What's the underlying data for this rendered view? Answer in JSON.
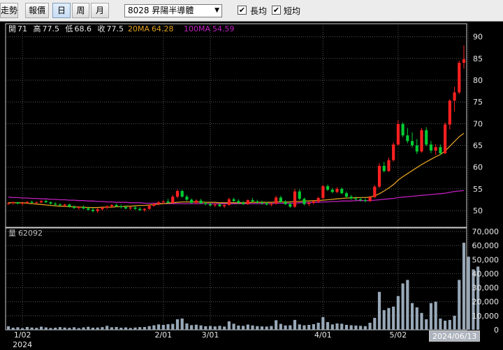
{
  "toolbar": {
    "buttons": [
      {
        "label": "走勢",
        "active": false
      },
      {
        "label": "報價",
        "active": false
      },
      {
        "label": "日",
        "active": true
      },
      {
        "label": "周",
        "active": false
      },
      {
        "label": "月",
        "active": false
      }
    ],
    "stock_select": "8028 昇陽半導體",
    "long_ma": {
      "label": "長均",
      "checked": true
    },
    "short_ma": {
      "label": "短均",
      "checked": true
    }
  },
  "info": {
    "open_label": "開",
    "open": "71",
    "high_label": "高",
    "high": "77.5",
    "low_label": "低",
    "low": "68.6",
    "close_label": "收",
    "close": "77.5",
    "ma20_label": "20MA",
    "ma20": "64.28",
    "ma100_label": "100MA",
    "ma100": "54.59",
    "volume_label": "量",
    "volume": "62092"
  },
  "date_flag": "2024/06/13",
  "colors": {
    "up": "#ff2020",
    "down": "#00cc33",
    "ma20": "#e0a020",
    "ma100": "#c020c0",
    "volume": "#98a8b8",
    "grid": "#555555"
  },
  "chart_data": {
    "type": "candlestick",
    "price_axis": {
      "ticks": [
        "50",
        "55",
        "60",
        "65",
        "70",
        "75",
        "80",
        "85",
        "90"
      ],
      "range": [
        46,
        93
      ]
    },
    "volume_axis": {
      "ticks": [
        "0",
        "10,000",
        "20,000",
        "30,000",
        "40,000",
        "50,000",
        "60,000",
        "70,000"
      ],
      "range": [
        0,
        70000
      ]
    },
    "x_labels": [
      "1/02",
      "2/01",
      "3/01",
      "4/01",
      "5/02",
      "6/0"
    ],
    "year_label": "2024",
    "candles": [
      [
        51.6,
        51.9,
        51.3,
        51.7
      ],
      [
        51.7,
        52.1,
        51.4,
        51.9
      ],
      [
        51.9,
        52.0,
        51.5,
        51.6
      ],
      [
        51.6,
        51.9,
        51.2,
        51.8
      ],
      [
        51.8,
        52.2,
        51.6,
        52.0
      ],
      [
        52.0,
        52.3,
        51.7,
        51.8
      ],
      [
        51.8,
        52.1,
        51.5,
        51.9
      ],
      [
        51.9,
        52.4,
        51.7,
        52.2
      ],
      [
        52.2,
        52.5,
        51.8,
        51.9
      ],
      [
        51.9,
        52.1,
        51.4,
        51.6
      ],
      [
        51.6,
        51.9,
        51.1,
        51.4
      ],
      [
        51.4,
        51.7,
        51.0,
        51.2
      ],
      [
        51.2,
        51.6,
        50.8,
        51.4
      ],
      [
        51.4,
        51.6,
        50.7,
        50.9
      ],
      [
        50.9,
        51.2,
        50.4,
        50.6
      ],
      [
        50.6,
        51.0,
        50.2,
        50.8
      ],
      [
        50.8,
        51.2,
        50.3,
        50.5
      ],
      [
        50.5,
        50.9,
        50.0,
        50.2
      ],
      [
        50.2,
        50.6,
        49.6,
        49.9
      ],
      [
        49.9,
        50.6,
        49.5,
        50.3
      ],
      [
        50.3,
        50.9,
        50.0,
        50.7
      ],
      [
        50.7,
        51.2,
        50.3,
        51.0
      ],
      [
        51.0,
        51.5,
        50.6,
        51.3
      ],
      [
        51.3,
        51.6,
        50.8,
        51.0
      ],
      [
        51.0,
        51.4,
        50.5,
        50.8
      ],
      [
        50.8,
        51.2,
        50.3,
        50.5
      ],
      [
        50.5,
        50.9,
        50.1,
        50.7
      ],
      [
        50.7,
        51.1,
        50.2,
        50.4
      ],
      [
        50.4,
        50.8,
        49.9,
        50.1
      ],
      [
        50.1,
        50.6,
        49.7,
        50.4
      ],
      [
        50.4,
        51.3,
        50.2,
        51.1
      ],
      [
        51.1,
        51.8,
        50.9,
        51.5
      ],
      [
        51.5,
        52.2,
        51.2,
        51.9
      ],
      [
        51.9,
        52.4,
        51.5,
        52.1
      ],
      [
        52.1,
        52.7,
        51.7,
        51.8
      ],
      [
        51.8,
        53.6,
        51.6,
        53.2
      ],
      [
        53.2,
        54.9,
        52.8,
        54.5
      ],
      [
        54.5,
        54.8,
        53.0,
        53.2
      ],
      [
        53.2,
        53.6,
        52.2,
        52.5
      ],
      [
        52.5,
        52.8,
        51.6,
        51.8
      ],
      [
        51.8,
        52.6,
        51.5,
        52.3
      ],
      [
        52.3,
        52.7,
        51.6,
        51.7
      ],
      [
        51.7,
        52.0,
        51.2,
        51.5
      ],
      [
        51.5,
        51.8,
        50.9,
        51.2
      ],
      [
        51.2,
        51.6,
        50.8,
        51.4
      ],
      [
        51.4,
        51.7,
        50.9,
        51.0
      ],
      [
        51.0,
        51.5,
        50.6,
        51.3
      ],
      [
        51.3,
        53.0,
        51.1,
        52.6
      ],
      [
        52.6,
        53.0,
        52.0,
        52.2
      ],
      [
        52.2,
        52.6,
        51.5,
        51.8
      ],
      [
        51.8,
        52.2,
        51.3,
        51.5
      ],
      [
        51.5,
        52.6,
        51.3,
        52.4
      ],
      [
        52.4,
        52.9,
        51.9,
        52.1
      ],
      [
        52.1,
        52.5,
        51.6,
        51.9
      ],
      [
        51.9,
        52.3,
        51.4,
        51.7
      ],
      [
        51.7,
        52.0,
        51.2,
        51.4
      ],
      [
        51.4,
        51.9,
        51.0,
        51.6
      ],
      [
        51.6,
        53.4,
        51.4,
        53.0
      ],
      [
        53.0,
        53.4,
        51.9,
        52.0
      ],
      [
        52.0,
        52.4,
        51.3,
        51.5
      ],
      [
        51.5,
        51.9,
        50.6,
        50.9
      ],
      [
        50.9,
        55.0,
        50.6,
        54.4
      ],
      [
        54.4,
        54.9,
        52.4,
        52.7
      ],
      [
        52.7,
        53.0,
        51.2,
        51.5
      ],
      [
        51.5,
        52.1,
        51.0,
        51.8
      ],
      [
        51.8,
        52.4,
        51.4,
        52.1
      ],
      [
        52.1,
        53.2,
        51.8,
        52.9
      ],
      [
        52.9,
        55.9,
        52.6,
        55.6
      ],
      [
        55.6,
        56.0,
        54.5,
        54.8
      ],
      [
        54.8,
        55.2,
        54.0,
        54.3
      ],
      [
        54.3,
        55.4,
        54.0,
        55.0
      ],
      [
        55.0,
        55.3,
        53.8,
        54.0
      ],
      [
        54.0,
        54.4,
        52.9,
        53.2
      ],
      [
        53.2,
        53.6,
        52.5,
        52.8
      ],
      [
        52.8,
        53.2,
        52.3,
        52.6
      ],
      [
        52.6,
        53.0,
        52.1,
        52.4
      ],
      [
        52.4,
        52.8,
        51.9,
        52.2
      ],
      [
        52.2,
        53.4,
        52.0,
        53.1
      ],
      [
        53.1,
        55.9,
        52.9,
        55.5
      ],
      [
        55.5,
        60.9,
        55.2,
        60.3
      ],
      [
        60.3,
        61.2,
        58.8,
        59.1
      ],
      [
        59.1,
        62.2,
        58.9,
        61.6
      ],
      [
        61.6,
        65.7,
        61.3,
        65.2
      ],
      [
        65.2,
        70.8,
        64.9,
        69.9
      ],
      [
        69.9,
        70.3,
        66.9,
        67.3
      ],
      [
        67.3,
        69.0,
        65.5,
        66.0
      ],
      [
        66.0,
        68.0,
        64.5,
        65.0
      ],
      [
        65.0,
        66.5,
        63.0,
        63.6
      ],
      [
        63.6,
        69.0,
        63.3,
        68.5
      ],
      [
        68.5,
        69.2,
        64.8,
        65.2
      ],
      [
        65.2,
        66.0,
        63.2,
        63.8
      ],
      [
        63.8,
        65.3,
        62.8,
        64.6
      ],
      [
        64.6,
        65.2,
        62.8,
        63.2
      ],
      [
        63.2,
        70.3,
        63.0,
        69.8
      ],
      [
        69.8,
        75.6,
        68.7,
        75.3
      ],
      [
        75.3,
        78.5,
        72.8,
        77.2
      ],
      [
        77.2,
        84.5,
        76.8,
        84.0
      ],
      [
        84.0,
        88.0,
        82.7,
        84.8
      ]
    ],
    "ma20": [
      51.8,
      51.8,
      51.8,
      51.8,
      51.7,
      51.6,
      51.5,
      51.4,
      51.3,
      51.2,
      51.1,
      51.0,
      51.0,
      50.9,
      50.9,
      50.8,
      50.8,
      50.7,
      50.7,
      50.7,
      50.8,
      50.8,
      50.8,
      50.9,
      50.9,
      51.0,
      51.0,
      51.1,
      51.2,
      51.2,
      51.3,
      51.4,
      51.5,
      51.6,
      51.7,
      51.8,
      51.9,
      52.0,
      52.0,
      52.0,
      52.0,
      52.0,
      51.9,
      51.9,
      51.9,
      51.8,
      51.8,
      51.8,
      51.8,
      51.8,
      51.8,
      51.8,
      51.9,
      51.9,
      51.9,
      51.9,
      51.9,
      52.0,
      52.0,
      52.0,
      52.0,
      52.1,
      52.1,
      52.2,
      52.2,
      52.3,
      52.3,
      52.4,
      52.5,
      52.6,
      52.7,
      52.8,
      52.9,
      52.9,
      53.0,
      53.0,
      53.0,
      53.1,
      53.4,
      53.9,
      54.5,
      55.2,
      56.0,
      57.0,
      57.8,
      58.5,
      59.2,
      59.9,
      60.6,
      61.2,
      61.8,
      62.4,
      62.9,
      63.7,
      64.8,
      65.9,
      67.0,
      67.8
    ],
    "ma100": [
      53.1,
      53.0,
      53.0,
      52.9,
      52.9,
      52.8,
      52.8,
      52.7,
      52.7,
      52.6,
      52.6,
      52.5,
      52.5,
      52.4,
      52.4,
      52.3,
      52.3,
      52.2,
      52.2,
      52.1,
      52.1,
      52.0,
      52.0,
      51.9,
      51.9,
      51.9,
      51.8,
      51.8,
      51.8,
      51.7,
      51.7,
      51.7,
      51.7,
      51.6,
      51.6,
      51.6,
      51.6,
      51.6,
      51.6,
      51.6,
      51.6,
      51.6,
      51.6,
      51.6,
      51.6,
      51.6,
      51.6,
      51.6,
      51.6,
      51.6,
      51.6,
      51.6,
      51.6,
      51.6,
      51.6,
      51.6,
      51.6,
      51.7,
      51.7,
      51.7,
      51.7,
      51.7,
      51.8,
      51.8,
      51.8,
      51.9,
      51.9,
      52.0,
      52.0,
      52.1,
      52.1,
      52.2,
      52.2,
      52.2,
      52.3,
      52.3,
      52.3,
      52.3,
      52.4,
      52.5,
      52.6,
      52.7,
      52.8,
      53.0,
      53.1,
      53.2,
      53.3,
      53.4,
      53.5,
      53.6,
      53.7,
      53.8,
      53.9,
      54.0,
      54.2,
      54.4,
      54.5,
      54.6
    ],
    "volumes": [
      2500,
      1500,
      1800,
      1200,
      2000,
      1600,
      1400,
      2200,
      1700,
      1300,
      1500,
      1900,
      1600,
      1400,
      1800,
      1200,
      1700,
      2100,
      1500,
      1600,
      1900,
      2800,
      1800,
      2000,
      1500,
      1700,
      1300,
      1600,
      1900,
      2000,
      2600,
      3200,
      3800,
      3500,
      4000,
      4200,
      7500,
      8000,
      4500,
      3300,
      3600,
      3100,
      2500,
      2700,
      2400,
      2800,
      2300,
      6000,
      4300,
      3000,
      2800,
      3700,
      3100,
      2600,
      2400,
      2300,
      2700,
      6800,
      4200,
      3100,
      3200,
      7000,
      3800,
      3200,
      3500,
      4000,
      5000,
      9000,
      5500,
      3800,
      4500,
      4300,
      3500,
      3200,
      3000,
      2800,
      2600,
      5000,
      8500,
      27000,
      14000,
      15500,
      16500,
      24000,
      33000,
      35500,
      19000,
      16000,
      12000,
      7500,
      19000,
      20000,
      8000,
      6500,
      7000,
      10000,
      35500,
      62000,
      52000,
      43000,
      45000
    ]
  }
}
